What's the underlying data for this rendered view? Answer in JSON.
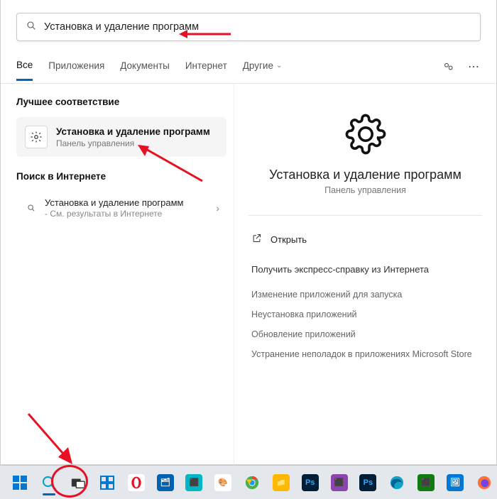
{
  "search": {
    "value": "Установка и удаление программ"
  },
  "tabs": {
    "all": "Все",
    "apps": "Приложения",
    "docs": "Документы",
    "web": "Интернет",
    "more": "Другие"
  },
  "left": {
    "best_header": "Лучшее соответствие",
    "best": {
      "title": "Установка и удаление программ",
      "sub": "Панель управления"
    },
    "web_header": "Поиск в Интернете",
    "web_item": {
      "title": "Установка и удаление программ",
      "sub": "- См. результаты в Интернете"
    }
  },
  "right": {
    "title": "Установка и удаление программ",
    "sub": "Панель управления",
    "open": "Открыть",
    "help_header": "Получить экспресс-справку из Интернета",
    "links": [
      "Изменение приложений для запуска",
      "Неустановка приложений",
      "Обновление приложений",
      "Устранение неполадок в приложениях Microsoft Store"
    ]
  }
}
